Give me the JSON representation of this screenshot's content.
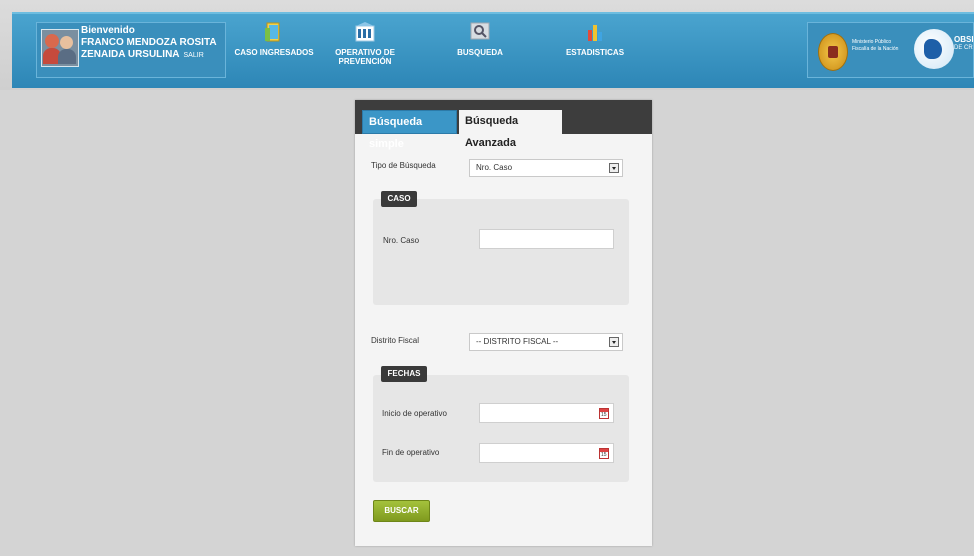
{
  "user": {
    "welcome": "Bienvenido",
    "name_line1": "FRANCO MENDOZA ROSITA",
    "name_line2": "ZENAIDA URSULINA",
    "logout": "SALIR"
  },
  "nav": {
    "caso_ingresados": "CASO INGRESADOS",
    "operativo_line1": "OPERATIVO DE",
    "operativo_line2": "PREVENCIÓN",
    "busqueda": "BUSQUEDA",
    "estadisticas": "ESTADISTICAS"
  },
  "logos": {
    "ministry_line1": "Ministerio Público",
    "ministry_line2": "Fiscalía de la Nación",
    "observatorio_line1": "OBSERVATO",
    "observatorio_line2": "DE CRIMINAL"
  },
  "tabs": {
    "simple": "Búsqueda simple",
    "advanced": "Búsqueda Avanzada"
  },
  "form": {
    "tipo_label": "Tipo de Búsqueda",
    "tipo_value": "Nro. Caso",
    "caso_legend": "CASO",
    "nro_caso_label": "Nro. Caso",
    "nro_caso_value": "",
    "distrito_label": "Distrito Fiscal",
    "distrito_value": "-- DISTRITO FISCAL --",
    "fechas_legend": "FECHAS",
    "inicio_label": "Inicio de operativo",
    "inicio_value": "",
    "fin_label": "Fin de operativo",
    "fin_value": "",
    "calendar_day": "15",
    "submit": "BUSCAR"
  },
  "colors": {
    "header": "#2d86b6",
    "tab_active": "#3b96c7",
    "button": "#8fab2a"
  }
}
